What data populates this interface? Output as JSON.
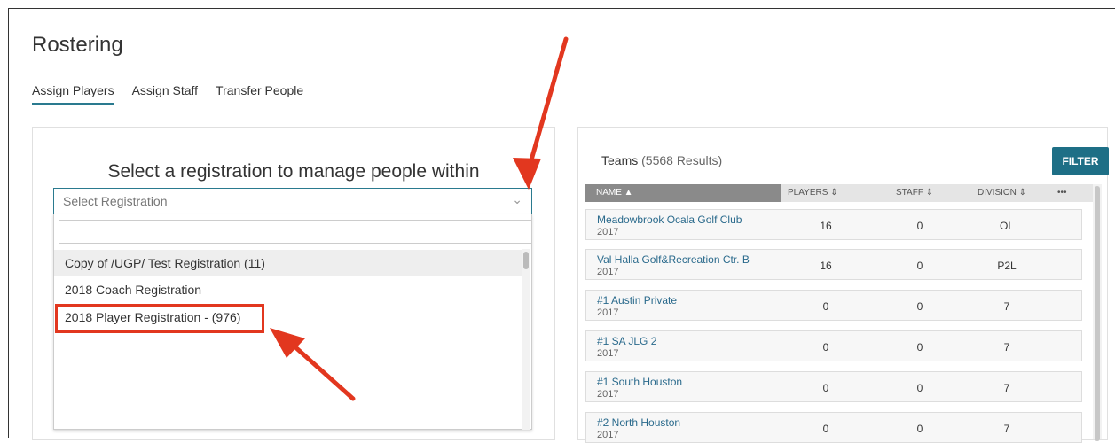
{
  "page": {
    "title": "Rostering"
  },
  "tabs": [
    {
      "label": "Assign Players"
    },
    {
      "label": "Assign Staff"
    },
    {
      "label": "Transfer People"
    }
  ],
  "registration": {
    "heading": "Select a registration to manage people within",
    "select_placeholder": "Select Registration",
    "options": [
      {
        "label": "Copy of /UGP/ Test Registration (11)"
      },
      {
        "label": "2018 Coach Registration"
      },
      {
        "label": "2018 Player Registration - (976)"
      }
    ]
  },
  "teams": {
    "title": "Teams",
    "results": "(5568 Results)",
    "filter_label": "FILTER",
    "columns": {
      "name": "NAME ▲",
      "players": "PLAYERS ⇕",
      "staff": "STAFF ⇕",
      "division": "DIVISION ⇕",
      "more": "•••"
    },
    "rows": [
      {
        "name": "Meadowbrook Ocala Golf Club",
        "year": "2017",
        "players": "16",
        "staff": "0",
        "division": "OL"
      },
      {
        "name": "Val Halla Golf&Recreation Ctr. B",
        "year": "2017",
        "players": "16",
        "staff": "0",
        "division": "P2L"
      },
      {
        "name": "#1 Austin Private",
        "year": "2017",
        "players": "0",
        "staff": "0",
        "division": "7"
      },
      {
        "name": "#1 SA JLG 2",
        "year": "2017",
        "players": "0",
        "staff": "0",
        "division": "7"
      },
      {
        "name": "#1 South Houston",
        "year": "2017",
        "players": "0",
        "staff": "0",
        "division": "7"
      },
      {
        "name": "#2 North Houston",
        "year": "2017",
        "players": "0",
        "staff": "0",
        "division": "7"
      }
    ]
  },
  "colors": {
    "accent": "#2a7a8f",
    "filter_bg": "#1e6f86",
    "annotation": "#e2371f"
  }
}
